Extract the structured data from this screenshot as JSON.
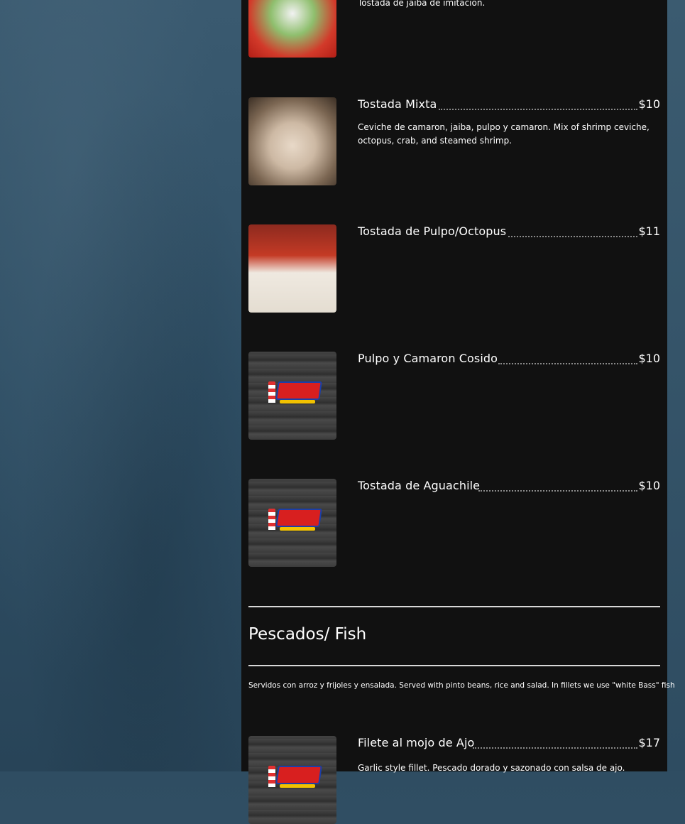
{
  "items": [
    {
      "image": "tostada-jaiba-photo",
      "desc": "Tostada de jaiba de imitación."
    },
    {
      "name": "Tostada Mixta",
      "price": "$10",
      "image": "tostada-mixta-photo",
      "desc": "Ceviche de camaron, jaiba, pulpo y camaron. Mix of shrimp ceviche, octopus, crab, and steamed shrimp."
    },
    {
      "name": "Tostada de Pulpo/Octopus",
      "price": "$11",
      "image": "tostada-pulpo-photo"
    },
    {
      "name": "Pulpo y Camaron Cosido",
      "price": "$10",
      "image": "mariscos-morales-logo"
    },
    {
      "name": "Tostada de Aguachile",
      "price": "$10",
      "image": "mariscos-morales-logo"
    }
  ],
  "section": {
    "title": "Pescados/ Fish",
    "note": "Servidos con arroz y frijoles y ensalada. Served with pinto beans, rice and salad. In fillets we use \"white Bass\" fish"
  },
  "fish_items": [
    {
      "name": "Filete al mojo de Ajo",
      "price": "$17",
      "image": "mariscos-morales-logo",
      "desc": "Garlic style fillet. Pescado dorado y sazonado con salsa de ajo."
    }
  ]
}
